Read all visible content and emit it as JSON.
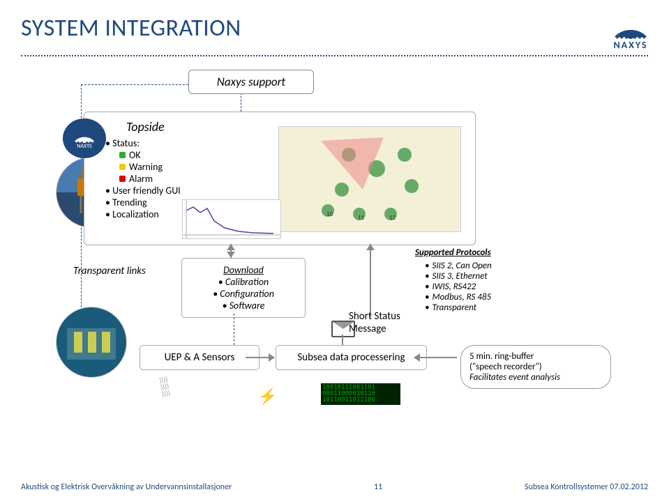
{
  "title": "SYSTEM INTEGRATION",
  "brand": "NAXYS",
  "support_box": "Naxys support",
  "topside": {
    "title": "Topside",
    "status_label": "Status:",
    "statuses": [
      "OK",
      "Warning",
      "Alarm"
    ],
    "items": [
      "User friendly GUI",
      "Trending",
      "Localization"
    ]
  },
  "transparent_links": "Transparent links",
  "download": {
    "title": "Download",
    "items": [
      "Calibration",
      "Configuration",
      "Software"
    ]
  },
  "protocols": {
    "header": "Supported Protocols",
    "items": [
      "SIIS 2, Can Open",
      "SIIS 3, Ethernet",
      "IWIS, RS422",
      "Modbus, RS 485",
      "Transparent"
    ]
  },
  "short_status": {
    "l1": "Short Status",
    "l2": "Message"
  },
  "uep": "UEP & A Sensors",
  "subsea_proc": "Subsea data processering",
  "ring_buffer": {
    "l1": "5 min. ring-buffer",
    "l2": "(\"speech recorder\")",
    "l3": "Facilitates event analysis"
  },
  "binary": "10010111001101\n00011000010110\n10110011011100",
  "footer": {
    "left": "Akustisk og Elektrisk Overvåkning av Undervannsinstallasjoner",
    "center": "11",
    "right": "Subsea Kontrollsystemer 07.02.2012"
  }
}
